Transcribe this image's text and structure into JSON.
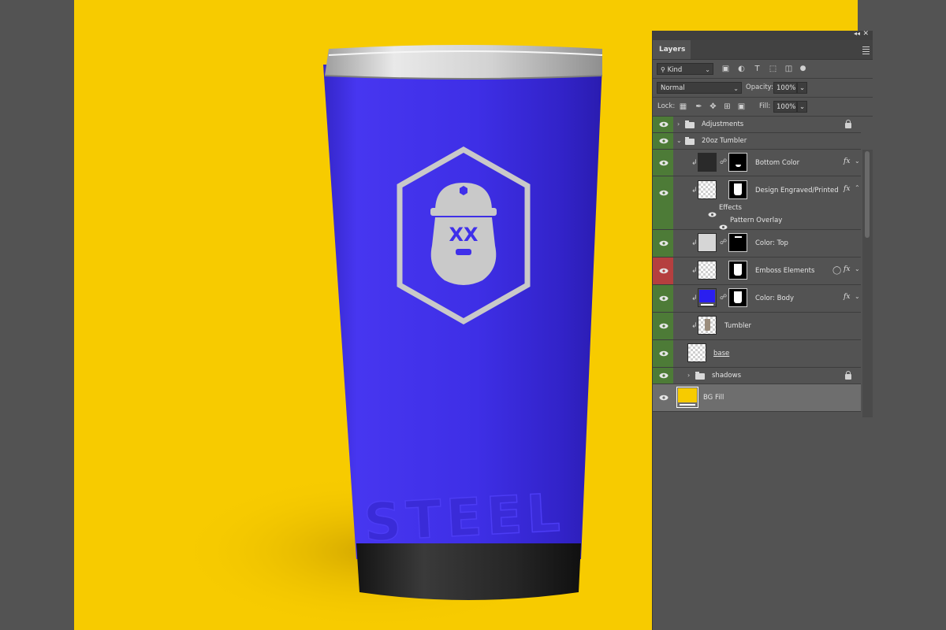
{
  "mockup": {
    "engraved_text": "STEEL",
    "logo_text": "XX",
    "colors": {
      "background": "#f7cb00",
      "body": "#3f2fea",
      "lid": "#cfcfcf",
      "base": "#222222",
      "logo": "#c9c9c9"
    }
  },
  "panel": {
    "tab": "Layers",
    "filter": {
      "label": "Kind"
    },
    "blend_mode": "Normal",
    "opacity_label": "Opacity:",
    "opacity": "100%",
    "lock_label": "Lock:",
    "fill_label": "Fill:",
    "fill": "100%",
    "layers": [
      {
        "name": "Adjustments",
        "type": "group",
        "locked": true,
        "visible_color": "#4d7b37"
      },
      {
        "name": "20oz Tumbler",
        "type": "group",
        "expanded": true
      },
      {
        "name": "Bottom Color",
        "fx": "fx"
      },
      {
        "name": "Design Engraved/Printed",
        "fx": "fx"
      },
      {
        "name": "Effects"
      },
      {
        "name": "Pattern Overlay"
      },
      {
        "name": "Color: Top"
      },
      {
        "name": "Emboss Elements",
        "fx": "fx",
        "eye_color": "#b53f3f"
      },
      {
        "name": "Color: Body",
        "fx": "fx",
        "swatch": "#2a1ff0"
      },
      {
        "name": "Tumbler"
      },
      {
        "name": "base"
      },
      {
        "name": "shadows",
        "type": "group",
        "locked": true
      },
      {
        "name": "BG Fill",
        "swatch": "#f7cb00",
        "selected": true
      }
    ]
  }
}
